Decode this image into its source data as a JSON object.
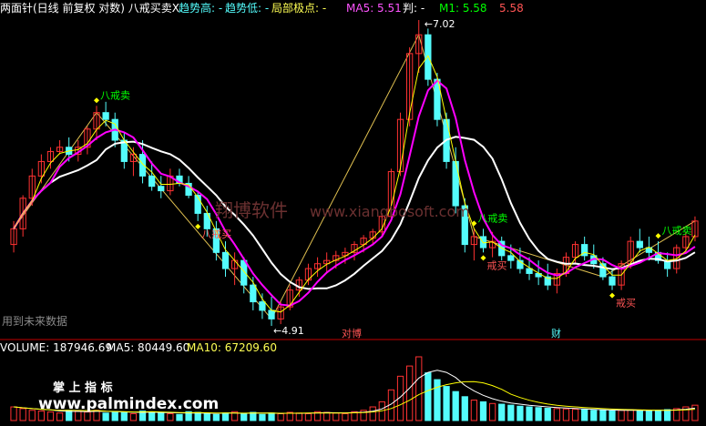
{
  "header": {
    "indicator_name": "两面针(日线 前复权 对数) 八戒买卖X",
    "trend_high_label": "趋势高: -",
    "trend_low_label": "趋势低: -",
    "local_extreme_label": "局部极点: -",
    "ma5_label": "MA5: 5.51",
    "judge_label": "判: -",
    "m1_label": "M1: 5.58",
    "m2_value": "5.58"
  },
  "watermark": {
    "cn": "翔博软件",
    "url": "www.xiangbosoft.com"
  },
  "future_data_note": "用到未来数据",
  "markers": {
    "sell_label": "八戒卖",
    "buy_label": "八戒买",
    "short_buy_label": "戒买",
    "price_high": "7.02",
    "price_low": "4.91",
    "badge_1": "对博",
    "badge_2": "财"
  },
  "volume_header": {
    "volume_label": "VOLUME: 187946.69",
    "ma5_label": "MA5: 80449.60",
    "ma10_label": "MA10: 67209.60"
  },
  "bottom_watermark": {
    "cn": "掌 上 指 标",
    "url": "www.palmindex.com"
  },
  "colors": {
    "up": "#ff3232",
    "down": "#54fcfc",
    "ma_white": "#ffffff",
    "ma_magenta": "#ff00ff",
    "ma_green": "#00e000",
    "zigzag": "#e0c050",
    "yellow": "#ffff00",
    "header_cyan": "#54fcfc",
    "header_yellow": "#ffff54",
    "header_pink": "#ff54ff",
    "header_green": "#00ff00",
    "header_red": "#ff5454"
  },
  "chart_data": {
    "type": "candlestick",
    "title": "两面针(日线 前复权 对数) 八戒买卖X",
    "price_range": [
      4.91,
      7.02
    ],
    "series": [
      {
        "name": "price_ohlc",
        "values": [
          [
            5.4,
            5.55,
            5.35,
            5.5
          ],
          [
            5.5,
            5.72,
            5.45,
            5.7
          ],
          [
            5.7,
            5.9,
            5.65,
            5.85
          ],
          [
            5.85,
            6.0,
            5.8,
            5.95
          ],
          [
            5.95,
            6.05,
            5.9,
            6.02
          ],
          [
            6.02,
            6.1,
            6.0,
            6.05
          ],
          [
            6.05,
            6.12,
            5.95,
            6.0
          ],
          [
            6.0,
            6.1,
            5.95,
            6.05
          ],
          [
            6.05,
            6.2,
            6.0,
            6.18
          ],
          [
            6.18,
            6.35,
            6.1,
            6.3
          ],
          [
            6.3,
            6.38,
            6.2,
            6.25
          ],
          [
            6.25,
            6.3,
            6.05,
            6.1
          ],
          [
            6.1,
            6.15,
            5.9,
            5.95
          ],
          [
            5.95,
            6.05,
            5.85,
            6.0
          ],
          [
            6.0,
            6.1,
            5.8,
            5.85
          ],
          [
            5.85,
            5.95,
            5.75,
            5.78
          ],
          [
            5.78,
            5.85,
            5.7,
            5.75
          ],
          [
            5.75,
            5.9,
            5.72,
            5.85
          ],
          [
            5.85,
            5.9,
            5.78,
            5.8
          ],
          [
            5.8,
            5.85,
            5.7,
            5.72
          ],
          [
            5.72,
            5.75,
            5.55,
            5.6
          ],
          [
            5.6,
            5.65,
            5.45,
            5.5
          ],
          [
            5.5,
            5.55,
            5.3,
            5.35
          ],
          [
            5.35,
            5.42,
            5.2,
            5.25
          ],
          [
            5.25,
            5.35,
            5.15,
            5.3
          ],
          [
            5.3,
            5.32,
            5.1,
            5.15
          ],
          [
            5.15,
            5.2,
            5.0,
            5.05
          ],
          [
            5.05,
            5.1,
            4.95,
            5.0
          ],
          [
            5.0,
            5.08,
            4.91,
            4.95
          ],
          [
            4.95,
            5.05,
            4.92,
            5.02
          ],
          [
            5.02,
            5.15,
            5.0,
            5.12
          ],
          [
            5.12,
            5.2,
            5.08,
            5.18
          ],
          [
            5.18,
            5.28,
            5.15,
            5.25
          ],
          [
            5.25,
            5.32,
            5.2,
            5.28
          ],
          [
            5.28,
            5.35,
            5.22,
            5.3
          ],
          [
            5.3,
            5.36,
            5.25,
            5.33
          ],
          [
            5.33,
            5.38,
            5.28,
            5.35
          ],
          [
            5.35,
            5.42,
            5.3,
            5.4
          ],
          [
            5.4,
            5.46,
            5.35,
            5.44
          ],
          [
            5.44,
            5.5,
            5.4,
            5.48
          ],
          [
            5.48,
            5.6,
            5.45,
            5.58
          ],
          [
            5.58,
            5.9,
            5.55,
            5.88
          ],
          [
            5.88,
            6.3,
            5.85,
            6.25
          ],
          [
            6.25,
            6.8,
            6.2,
            6.75
          ],
          [
            6.75,
            7.02,
            6.6,
            6.9
          ],
          [
            6.9,
            6.95,
            6.5,
            6.55
          ],
          [
            6.55,
            6.6,
            6.2,
            6.25
          ],
          [
            6.25,
            6.3,
            5.9,
            5.95
          ],
          [
            5.95,
            6.05,
            5.6,
            5.65
          ],
          [
            5.65,
            5.7,
            5.35,
            5.4
          ],
          [
            5.4,
            5.5,
            5.3,
            5.45
          ],
          [
            5.45,
            5.5,
            5.35,
            5.38
          ],
          [
            5.38,
            5.48,
            5.32,
            5.42
          ],
          [
            5.42,
            5.45,
            5.3,
            5.33
          ],
          [
            5.33,
            5.4,
            5.25,
            5.3
          ],
          [
            5.3,
            5.38,
            5.22,
            5.25
          ],
          [
            5.25,
            5.32,
            5.18,
            5.22
          ],
          [
            5.22,
            5.3,
            5.15,
            5.2
          ],
          [
            5.2,
            5.28,
            5.12,
            5.15
          ],
          [
            5.15,
            5.25,
            5.1,
            5.22
          ],
          [
            5.22,
            5.35,
            5.2,
            5.32
          ],
          [
            5.32,
            5.42,
            5.28,
            5.4
          ],
          [
            5.4,
            5.45,
            5.3,
            5.33
          ],
          [
            5.33,
            5.4,
            5.25,
            5.28
          ],
          [
            5.28,
            5.32,
            5.18,
            5.2
          ],
          [
            5.2,
            5.25,
            5.12,
            5.15
          ],
          [
            5.15,
            5.3,
            5.12,
            5.28
          ],
          [
            5.28,
            5.45,
            5.25,
            5.42
          ],
          [
            5.42,
            5.5,
            5.35,
            5.38
          ],
          [
            5.38,
            5.45,
            5.3,
            5.35
          ],
          [
            5.35,
            5.42,
            5.28,
            5.3
          ],
          [
            5.3,
            5.35,
            5.2,
            5.25
          ],
          [
            5.25,
            5.4,
            5.22,
            5.38
          ],
          [
            5.38,
            5.48,
            5.35,
            5.45
          ],
          [
            5.45,
            5.58,
            5.42,
            5.55
          ]
        ]
      },
      {
        "name": "volume",
        "values": [
          40,
          35,
          30,
          28,
          25,
          22,
          30,
          28,
          25,
          30,
          22,
          26,
          24,
          20,
          28,
          25,
          22,
          20,
          18,
          26,
          24,
          20,
          18,
          22,
          26,
          20,
          24,
          18,
          22,
          20,
          24,
          22,
          20,
          26,
          24,
          22,
          20,
          26,
          30,
          40,
          55,
          90,
          130,
          160,
          187,
          140,
          120,
          100,
          85,
          70,
          60,
          55,
          50,
          48,
          45,
          42,
          40,
          38,
          36,
          35,
          34,
          33,
          32,
          30,
          30,
          28,
          30,
          32,
          30,
          28,
          30,
          32,
          35,
          40,
          45
        ]
      }
    ]
  }
}
